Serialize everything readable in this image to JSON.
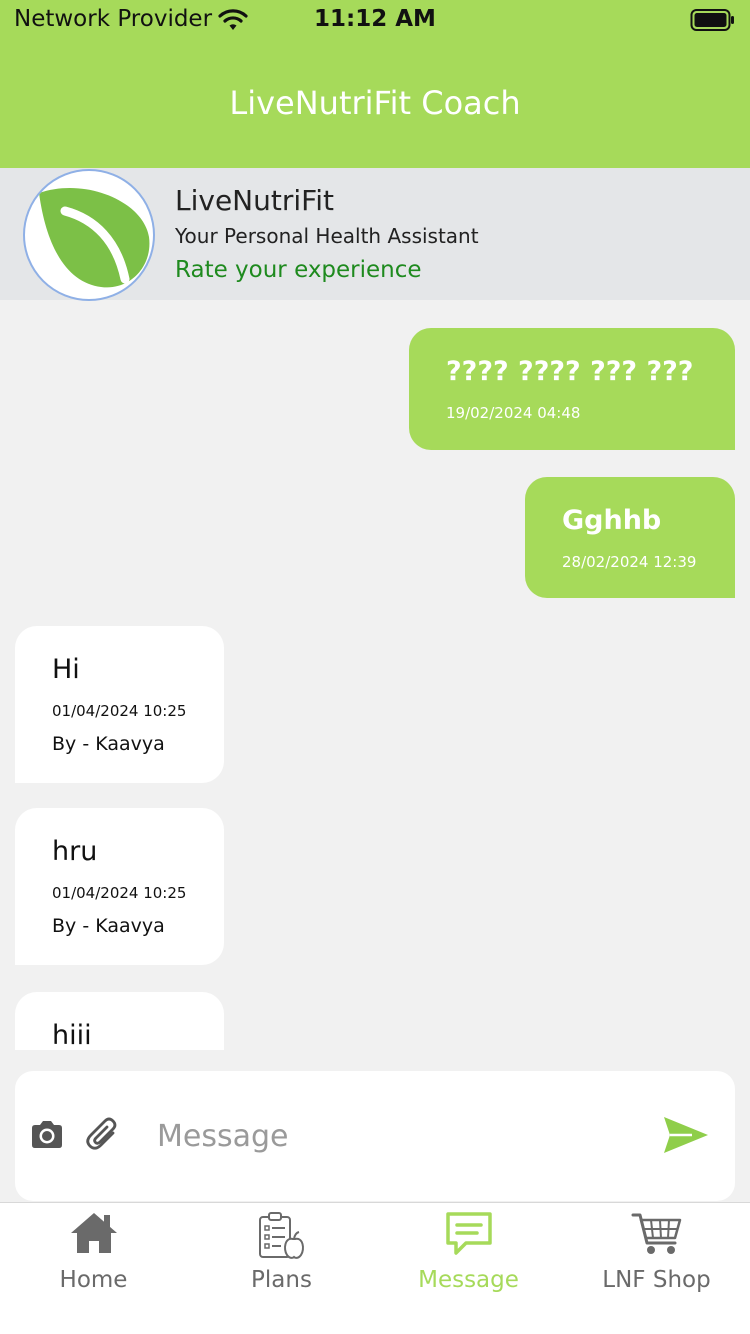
{
  "status_bar": {
    "carrier": "Network Provider",
    "time": "11:12 AM",
    "wifi_icon": "wifi-icon",
    "battery_icon": "battery-icon"
  },
  "header": {
    "title": "LiveNutriFit Coach"
  },
  "profile": {
    "name": "LiveNutriFit",
    "subtitle": "Your Personal Health Assistant",
    "rate_link": "Rate your experience",
    "avatar_icon": "leaf-logo-icon"
  },
  "messages": [
    {
      "type": "sent",
      "text": "???? ???? ??? ???",
      "time": "19/02/2024  04:48"
    },
    {
      "type": "sent",
      "text": "Gghhb",
      "time": "28/02/2024  12:39"
    },
    {
      "type": "received",
      "text": "Hi",
      "time": "01/04/2024  10:25",
      "by": "By - Kaavya"
    },
    {
      "type": "received",
      "text": "hru",
      "time": "01/04/2024  10:25",
      "by": "By - Kaavya"
    },
    {
      "type": "received",
      "text": "hiii"
    }
  ],
  "composer": {
    "placeholder": "Message",
    "value": "",
    "camera_icon": "camera-icon",
    "attach_icon": "paperclip-icon",
    "send_icon": "send-icon"
  },
  "tabs": [
    {
      "label": "Home",
      "icon": "home-icon",
      "active": false
    },
    {
      "label": "Plans",
      "icon": "plans-clipboard-icon",
      "active": false
    },
    {
      "label": "Message",
      "icon": "message-icon",
      "active": true
    },
    {
      "label": "LNF Shop",
      "icon": "shopping-cart-icon",
      "active": false
    }
  ],
  "colors": {
    "accent_green": "#a6da5a",
    "link_green": "#1e8a1e",
    "profile_bg": "#e4e6e8",
    "chat_bg": "#f1f1f1",
    "tab_inactive": "#6a6a6a"
  }
}
